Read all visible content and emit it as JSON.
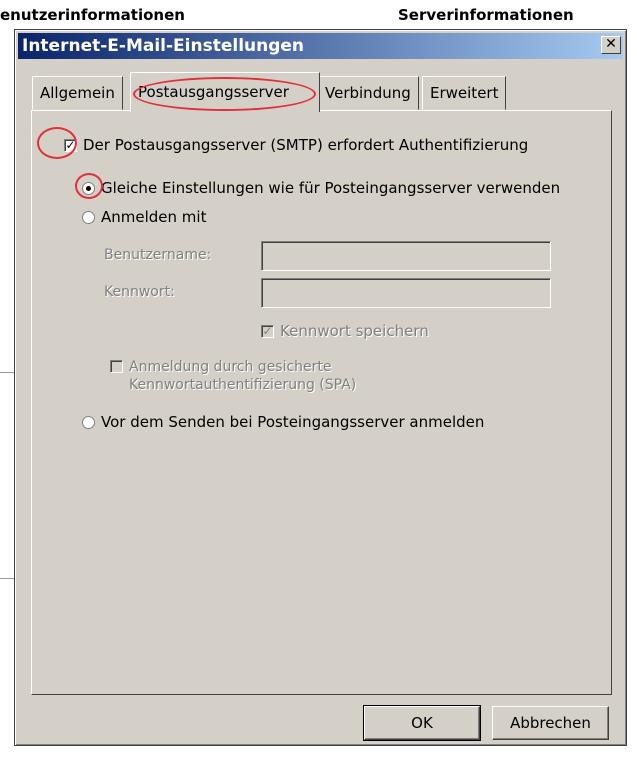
{
  "background": {
    "left_heading": "enutzerinformationen",
    "right_heading": "Serverinformationen"
  },
  "dialog": {
    "title": "Internet-E-Mail-Einstellungen",
    "close_glyph": "✕"
  },
  "tabs": [
    {
      "label": "Allgemein",
      "active": false
    },
    {
      "label": "Postausgangsserver",
      "active": true
    },
    {
      "label": "Verbindung",
      "active": false
    },
    {
      "label": "Erweitert",
      "active": false
    }
  ],
  "smtp_auth": {
    "label": "Der Postausgangsserver (SMTP) erfordert Authentifizierung",
    "checked": true
  },
  "radio_same": {
    "label": "Gleiche Einstellungen wie für Posteingangsserver verwenden",
    "checked": true
  },
  "radio_login": {
    "label": "Anmelden mit",
    "checked": false
  },
  "fields": {
    "username_label": "Benutzername:",
    "username_value": "",
    "password_label": "Kennwort:",
    "password_value": ""
  },
  "save_password": {
    "label": "Kennwort speichern",
    "checked": true
  },
  "spa": {
    "label_line1": "Anmeldung durch gesicherte",
    "label_line2": "Kennwortauthentifizierung (SPA)",
    "checked": false
  },
  "radio_before_send": {
    "label": "Vor dem Senden bei Posteingangsserver anmelden",
    "checked": false
  },
  "buttons": {
    "ok": "OK",
    "cancel": "Abbrechen"
  },
  "colors": {
    "marker": "#e0303a",
    "titlebar_start": "#0a246a"
  }
}
